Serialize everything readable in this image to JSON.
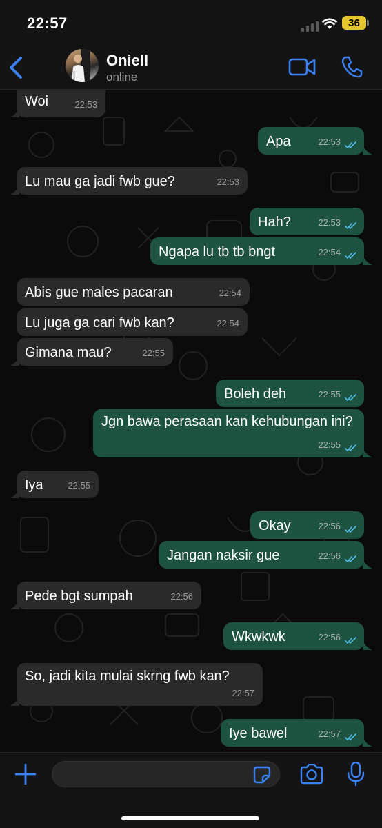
{
  "status_bar": {
    "time": "22:57",
    "battery": "36"
  },
  "header": {
    "name": "Oniell",
    "status": "online"
  },
  "messages": [
    {
      "dir": "in",
      "text": "Woi",
      "time": "22:53"
    },
    {
      "dir": "out",
      "text": "Apa",
      "time": "22:53"
    },
    {
      "dir": "in",
      "text": "Lu mau ga jadi fwb gue?",
      "time": "22:53"
    },
    {
      "dir": "out",
      "text": "Hah?",
      "time": "22:53"
    },
    {
      "dir": "out",
      "text": "Ngapa lu tb tb bngt",
      "time": "22:54"
    },
    {
      "dir": "in",
      "text": "Abis gue males pacaran",
      "time": "22:54"
    },
    {
      "dir": "in",
      "text": "Lu juga ga cari fwb kan?",
      "time": "22:54"
    },
    {
      "dir": "in",
      "text": "Gimana mau?",
      "time": "22:55"
    },
    {
      "dir": "out",
      "text": "Boleh deh",
      "time": "22:55"
    },
    {
      "dir": "out",
      "text": "Jgn bawa perasaan kan kehubungan ini?",
      "time": "22:55"
    },
    {
      "dir": "in",
      "text": "Iya",
      "time": "22:55"
    },
    {
      "dir": "out",
      "text": "Okay",
      "time": "22:56"
    },
    {
      "dir": "out",
      "text": "Jangan naksir gue",
      "time": "22:56"
    },
    {
      "dir": "in",
      "text": "Pede bgt sumpah",
      "time": "22:56"
    },
    {
      "dir": "out",
      "text": "Wkwkwk",
      "time": "22:56"
    },
    {
      "dir": "in",
      "text": "So, jadi kita mulai skrng fwb kan?",
      "time": "22:57"
    },
    {
      "dir": "out",
      "text": "Iye bawel",
      "time": "22:57"
    }
  ],
  "composer": {
    "value": ""
  },
  "colors": {
    "accent": "#3b82f6",
    "outgoing_bubble": "#1e5341",
    "incoming_bubble": "#2a2a2a",
    "read_ticks": "#53bdeb"
  },
  "icons": [
    "back-icon",
    "video-call-icon",
    "phone-icon",
    "plus-icon",
    "sticker-icon",
    "camera-icon",
    "microphone-icon",
    "read-receipt-icon"
  ]
}
